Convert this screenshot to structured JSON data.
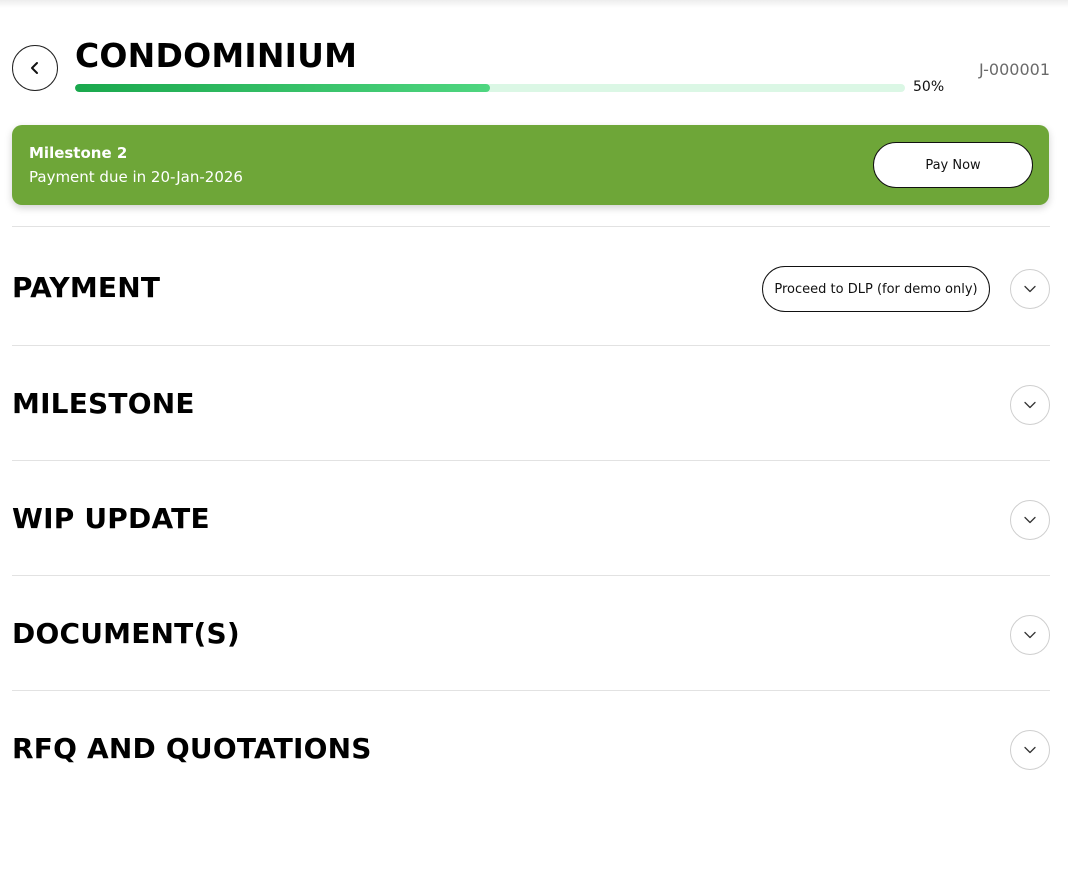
{
  "header": {
    "back_icon": "chevron-left-icon",
    "title": "CONDOMINIUM",
    "progress_percent": 50,
    "progress_label": "50%",
    "job_id": "J-000001",
    "progress_color_start": "#1aa84d",
    "progress_color_end": "#4fd680",
    "progress_track_color": "#dbf7e5"
  },
  "banner": {
    "title": "Milestone 2",
    "subtitle": "Payment due in 20-Jan-2026",
    "pay_button_label": "Pay Now",
    "background_color": "#6ea638"
  },
  "sections": [
    {
      "title": "PAYMENT",
      "action_label": "Proceed to DLP (for demo only)",
      "toggle_icon": "chevron-down-icon"
    },
    {
      "title": "MILESTONE",
      "toggle_icon": "chevron-down-icon"
    },
    {
      "title": "WIP UPDATE",
      "toggle_icon": "chevron-down-icon"
    },
    {
      "title": "DOCUMENT(S)",
      "toggle_icon": "chevron-down-icon"
    },
    {
      "title": "RFQ AND QUOTATIONS",
      "toggle_icon": "chevron-down-icon"
    }
  ]
}
